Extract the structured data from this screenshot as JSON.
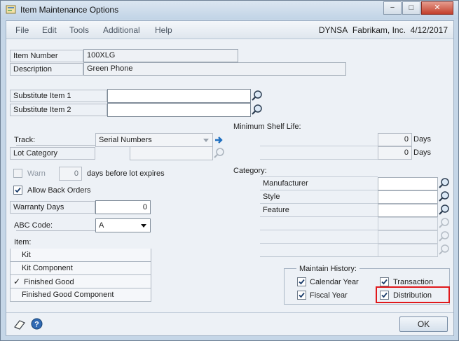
{
  "window": {
    "title": "Item Maintenance Options",
    "controls": {
      "minimize": "−",
      "maximize": "□",
      "close": "✕"
    }
  },
  "menu": {
    "items": [
      "File",
      "Edit",
      "Tools",
      "Additional",
      "Help"
    ],
    "company": "DYNSA",
    "company_name": "Fabrikam, Inc.",
    "date": "4/12/2017"
  },
  "item_number": {
    "label": "Item Number",
    "value": "100XLG"
  },
  "description": {
    "label": "Description",
    "value": "Green Phone"
  },
  "substitute1": {
    "label": "Substitute Item 1",
    "value": ""
  },
  "substitute2": {
    "label": "Substitute Item 2",
    "value": ""
  },
  "track": {
    "label": "Track:",
    "value": "Serial Numbers"
  },
  "lot_category": {
    "label": "Lot Category",
    "value": ""
  },
  "warn": {
    "label": "Warn",
    "days_value": "0",
    "suffix": "days before lot expires",
    "checked": false,
    "enabled": false
  },
  "allow_back_orders": {
    "label": "Allow Back Orders",
    "checked": true
  },
  "warranty": {
    "label": "Warranty Days",
    "value": "0"
  },
  "abc_code": {
    "label": "ABC Code:",
    "value": "A"
  },
  "item_types": {
    "label": "Item:",
    "rows": [
      {
        "label": "Kit",
        "selected": false
      },
      {
        "label": "Kit Component",
        "selected": false
      },
      {
        "label": "Finished Good",
        "selected": true
      },
      {
        "label": "Finished Good Component",
        "selected": false
      }
    ],
    "check_glyph": "✓"
  },
  "shelf_life": {
    "label": "Minimum Shelf Life:",
    "rows": [
      {
        "value": "0",
        "unit": "Days"
      },
      {
        "value": "0",
        "unit": "Days"
      }
    ]
  },
  "category": {
    "label": "Category:",
    "rows": [
      {
        "label": "Manufacturer",
        "value": ""
      },
      {
        "label": "Style",
        "value": ""
      },
      {
        "label": "Feature",
        "value": ""
      },
      {
        "label": "",
        "value": ""
      },
      {
        "label": "",
        "value": ""
      },
      {
        "label": "",
        "value": ""
      }
    ]
  },
  "maintain_history": {
    "label": "Maintain History:",
    "options": {
      "calendar_year": {
        "label": "Calendar Year",
        "checked": true
      },
      "transaction": {
        "label": "Transaction",
        "checked": true
      },
      "fiscal_year": {
        "label": "Fiscal Year",
        "checked": true
      },
      "distribution": {
        "label": "Distribution",
        "checked": true
      }
    }
  },
  "highlight_color": "#e0181b",
  "footer": {
    "ok_label": "OK"
  }
}
